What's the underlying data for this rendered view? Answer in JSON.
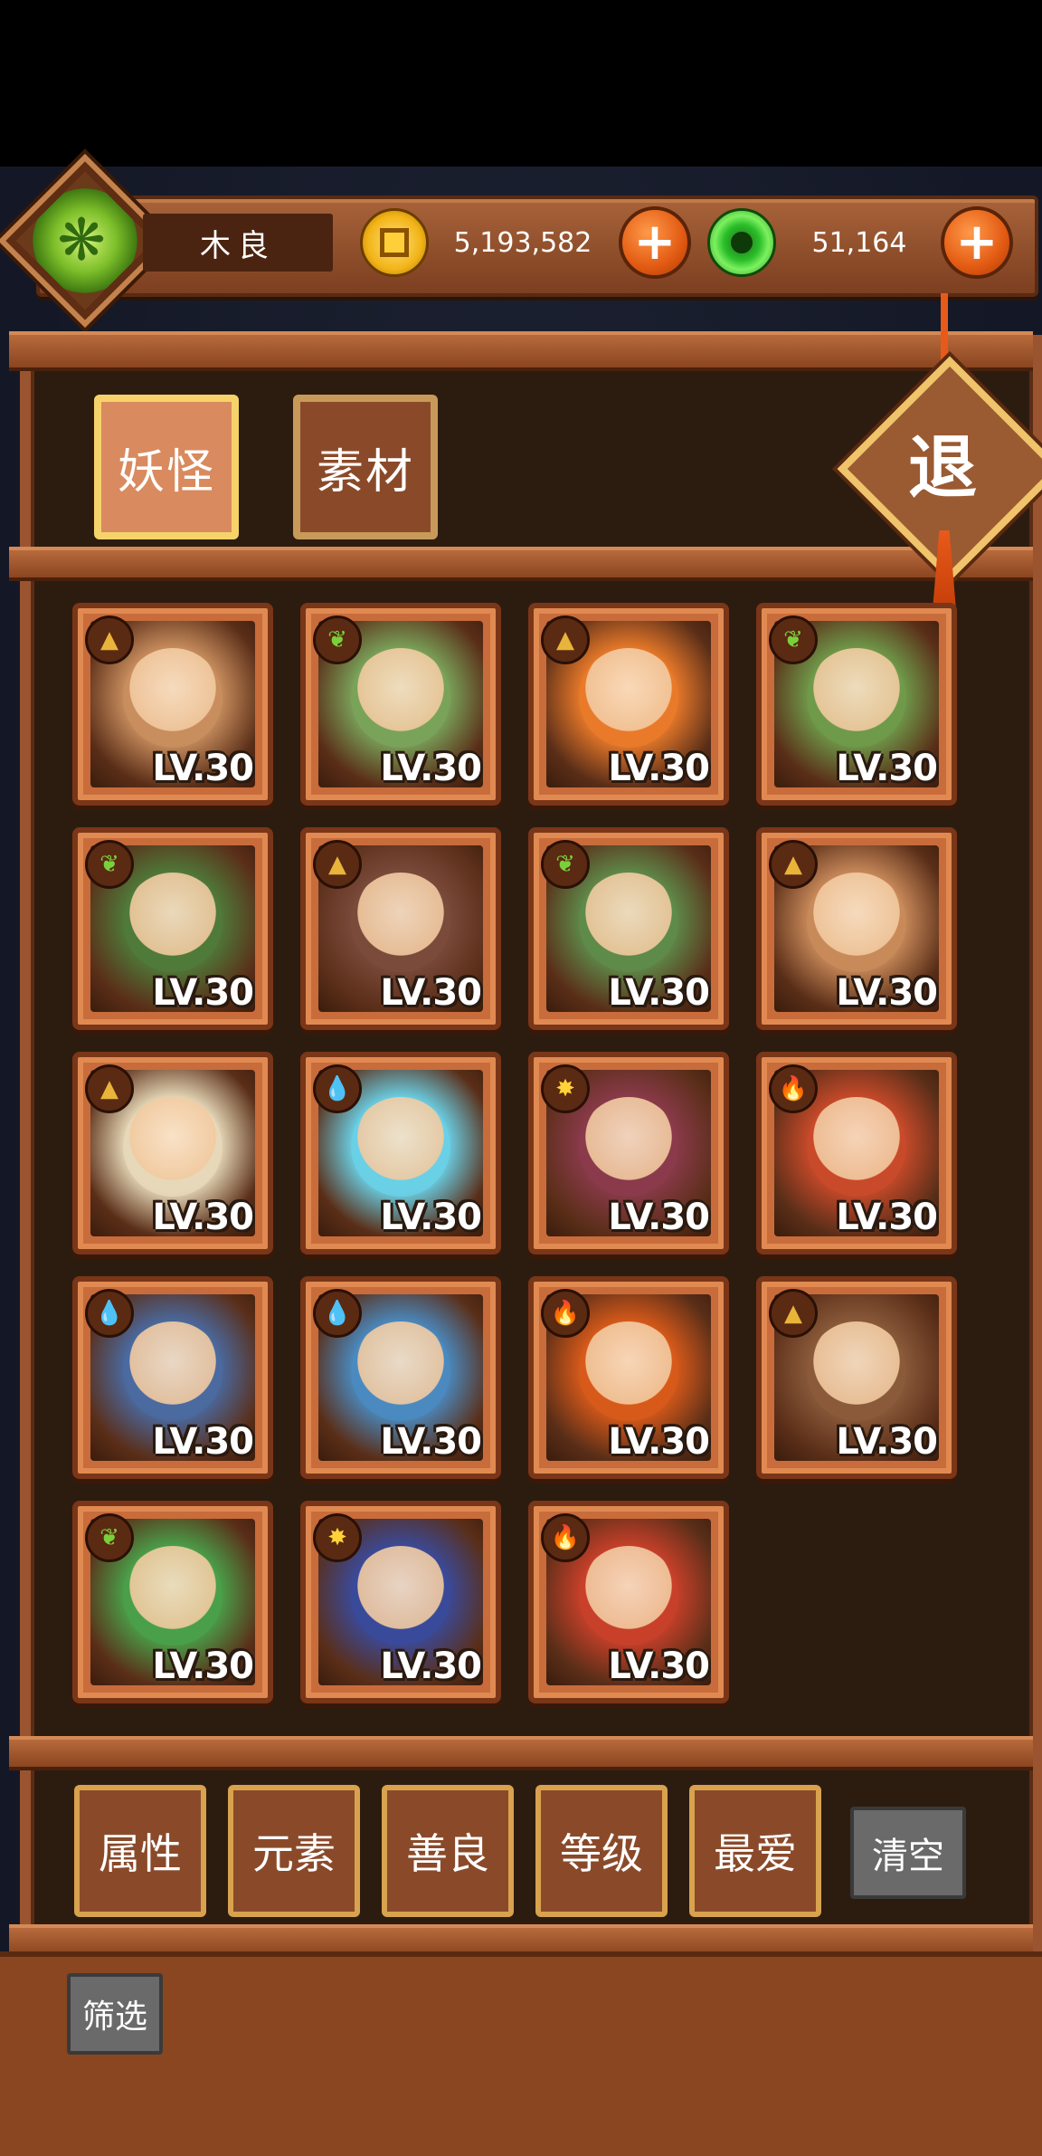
{
  "player": {
    "name": "木良",
    "avatar_icon": "jade-dragon-icon"
  },
  "currency": {
    "gold": {
      "amount": "5,193,582",
      "icon": "gold-coin-icon",
      "add_label": "+"
    },
    "jade": {
      "amount": "51,164",
      "icon": "jade-coin-icon",
      "add_label": "+"
    }
  },
  "tabs": [
    {
      "label": "妖怪",
      "active": true
    },
    {
      "label": "素材",
      "active": false
    }
  ],
  "exit_label": "退",
  "element_icons": {
    "earth": "▲",
    "wood": "❦",
    "water": "💧",
    "sun": "✸",
    "fire": "🔥"
  },
  "monsters": [
    {
      "element": "earth",
      "level": "LV.30",
      "color": "#c98e5e"
    },
    {
      "element": "wood",
      "level": "LV.30",
      "color": "#7aa35a"
    },
    {
      "element": "earth",
      "level": "LV.30",
      "color": "#e97a2a"
    },
    {
      "element": "wood",
      "level": "LV.30",
      "color": "#6f9a4a"
    },
    {
      "element": "wood",
      "level": "LV.30",
      "color": "#4f7a3a"
    },
    {
      "element": "earth",
      "level": "LV.30",
      "color": "#7a4a3a"
    },
    {
      "element": "wood",
      "level": "LV.30",
      "color": "#5e8a4a"
    },
    {
      "element": "earth",
      "level": "LV.30",
      "color": "#c98a5a"
    },
    {
      "element": "earth",
      "level": "LV.30",
      "color": "#e6d8b8"
    },
    {
      "element": "water",
      "level": "LV.30",
      "color": "#6ad0e6"
    },
    {
      "element": "sun",
      "level": "LV.30",
      "color": "#8a3a4a"
    },
    {
      "element": "fire",
      "level": "LV.30",
      "color": "#c84a2a"
    },
    {
      "element": "water",
      "level": "LV.30",
      "color": "#4a6aa0"
    },
    {
      "element": "water",
      "level": "LV.30",
      "color": "#4a8ac0"
    },
    {
      "element": "fire",
      "level": "LV.30",
      "color": "#d85a1a"
    },
    {
      "element": "earth",
      "level": "LV.30",
      "color": "#8a5a3a"
    },
    {
      "element": "wood",
      "level": "LV.30",
      "color": "#4aa04a"
    },
    {
      "element": "sun",
      "level": "LV.30",
      "color": "#3a4a9a"
    },
    {
      "element": "fire",
      "level": "LV.30",
      "color": "#c8402a"
    }
  ],
  "filters": [
    "属性",
    "元素",
    "善良",
    "等级",
    "最爱"
  ],
  "clear_label": "清空",
  "screen_label": "筛选"
}
